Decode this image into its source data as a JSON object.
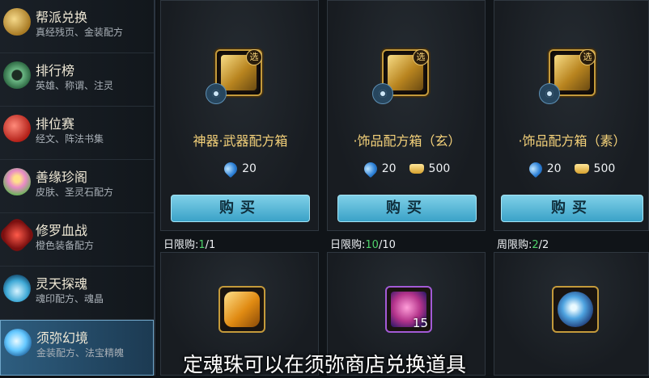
{
  "sidebar": {
    "items": [
      {
        "title": "帮派兑换",
        "sub": "真经残页、金装配方",
        "icon": "gold-bag-icon",
        "color": "#c9a24a"
      },
      {
        "title": "排行榜",
        "sub": "英雄、称谓、注灵",
        "icon": "jade-disc-icon",
        "color": "#4f9a66"
      },
      {
        "title": "排位赛",
        "sub": "经文、阵法书集",
        "icon": "red-gem-icon",
        "color": "#c2332d"
      },
      {
        "title": "善缘珍阁",
        "sub": "皮肤、圣灵石配方",
        "icon": "lotus-icon",
        "color": "#d978b8"
      },
      {
        "title": "修罗血战",
        "sub": "橙色装备配方",
        "icon": "red-crystal-icon",
        "color": "#9e2020"
      },
      {
        "title": "灵天探魂",
        "sub": "魂印配方、魂晶",
        "icon": "blue-flame-icon",
        "color": "#3fa9d6"
      },
      {
        "title": "须弥幻境",
        "sub": "金装配方、法宝精魄",
        "icon": "blue-orb-icon",
        "color": "#64c8ff",
        "active": true
      }
    ]
  },
  "cards": [
    {
      "title": "神器·武器配方箱",
      "badge": "选",
      "icon": "chest-icon",
      "gem_price": "20",
      "gold_price": "",
      "buy_label": "购买",
      "limit_label": "日限购:",
      "limit_count": "1",
      "limit_total": "/1"
    },
    {
      "title": "·饰品配方箱（玄）",
      "badge": "选",
      "icon": "chest-icon",
      "gem_price": "20",
      "gold_price": "500",
      "buy_label": "购买",
      "limit_label": "日限购:",
      "limit_count": "10",
      "limit_total": "/10"
    },
    {
      "title": "·饰品配方箱（素）",
      "badge": "选",
      "icon": "chest-icon",
      "gem_price": "20",
      "gold_price": "500",
      "buy_label": "购买",
      "limit_label": "周限购:",
      "limit_count": "2",
      "limit_total": "/2"
    }
  ],
  "bottom_items": [
    {
      "icon": "amber-gem-icon",
      "qty": ""
    },
    {
      "icon": "pink-ore-icon",
      "qty": "15"
    },
    {
      "icon": "blue-orb-icon",
      "qty": ""
    }
  ],
  "subtitle": "定魂珠可以在须弥商店兑换道具"
}
